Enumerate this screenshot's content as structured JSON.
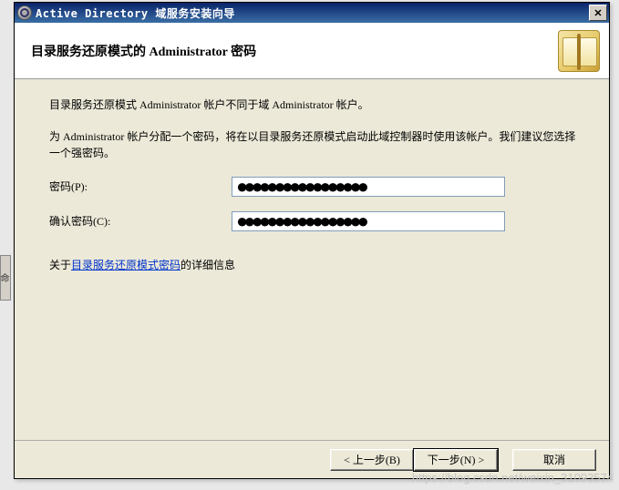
{
  "titlebar": {
    "title": "Active Directory 域服务安装向导",
    "close_label": "✕"
  },
  "header": {
    "title": "目录服务还原模式的 Administrator 密码"
  },
  "content": {
    "para1": "目录服务还原模式 Administrator 帐户不同于域 Administrator 帐户。",
    "para2": "为 Administrator 帐户分配一个密码，将在以目录服务还原模式启动此域控制器时使用该帐户。我们建议您选择一个强密码。",
    "password_label": "密码(P):",
    "confirm_label": "确认密码(C):",
    "password_value": "●●●●●●●●●●●●●●●●●",
    "confirm_value": "●●●●●●●●●●●●●●●●●",
    "link_prefix": "关于",
    "link_text": "目录服务还原模式密码",
    "link_suffix": "的详细信息"
  },
  "footer": {
    "back": "< 上一步(B)",
    "next": "下一步(N) >",
    "cancel": "取消"
  },
  "side": {
    "label": "命"
  },
  "watermark": "https://blog.csdn.net/weixin_31093574"
}
